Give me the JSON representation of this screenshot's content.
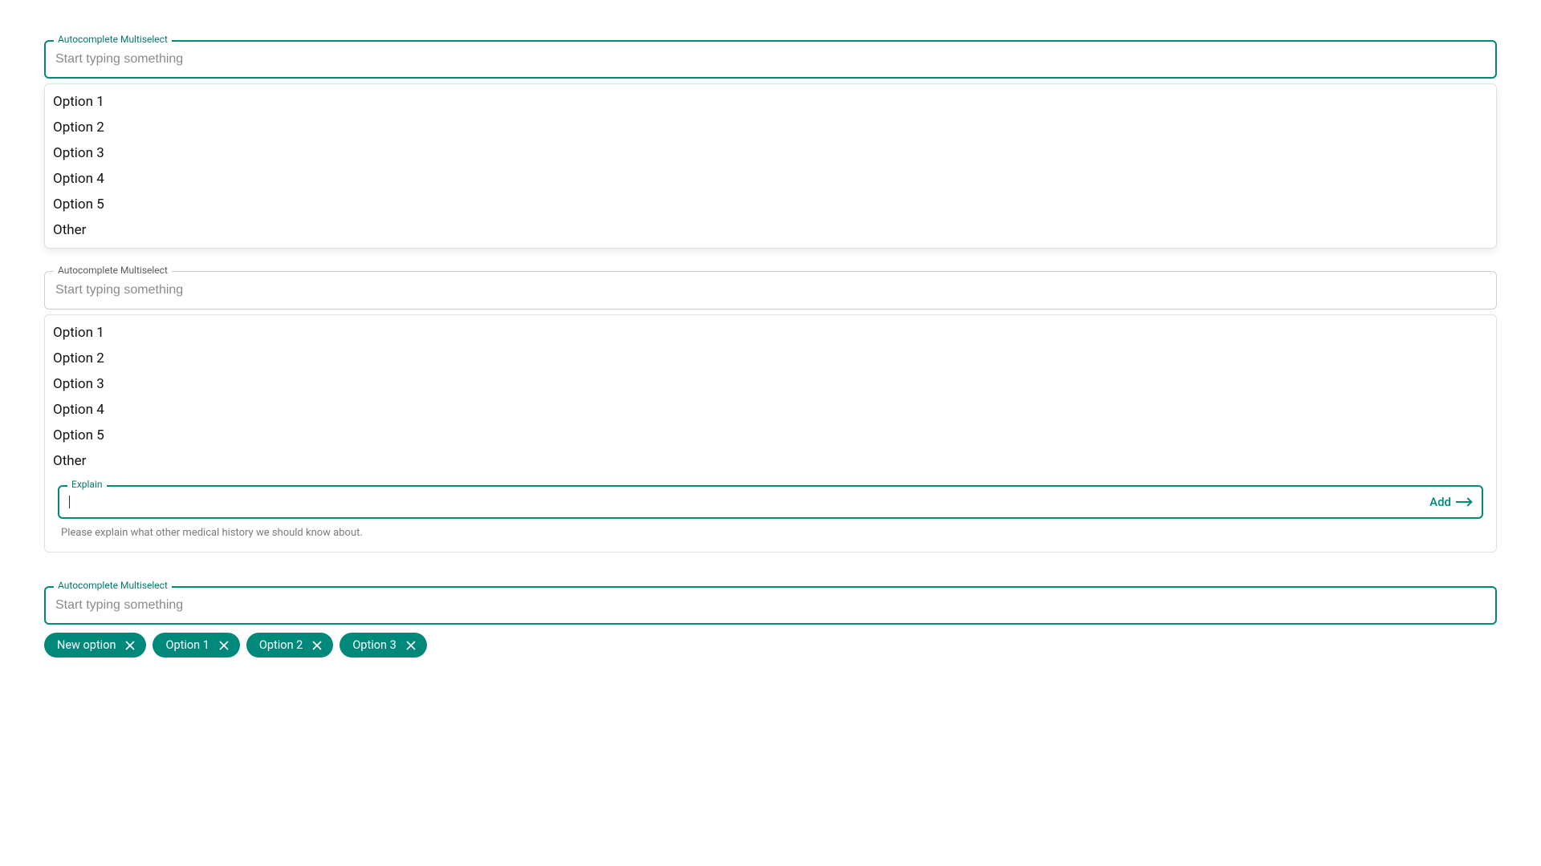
{
  "colors": {
    "accent": "#00897b"
  },
  "multiselect1": {
    "label": "Autocomplete Multiselect",
    "placeholder": "Start typing something",
    "options": [
      "Option 1",
      "Option 2",
      "Option 3",
      "Option 4",
      "Option 5",
      "Other"
    ]
  },
  "multiselect2": {
    "label": "Autocomplete Multiselect",
    "placeholder": "Start typing something",
    "options": [
      "Option 1",
      "Option 2",
      "Option 3",
      "Option 4",
      "Option 5",
      "Other"
    ],
    "explain": {
      "label": "Explain",
      "add_label": "Add",
      "helper": "Please explain what other medical history we should know about."
    }
  },
  "multiselect3": {
    "label": "Autocomplete Multiselect",
    "placeholder": "Start typing something",
    "chips": [
      "New option",
      "Option 1",
      "Option 2",
      "Option 3"
    ]
  }
}
